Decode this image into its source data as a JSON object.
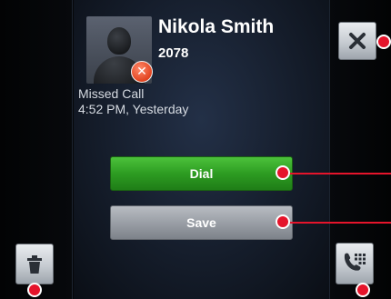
{
  "contact": {
    "name": "Nikola Smith",
    "extension": "2078"
  },
  "call": {
    "status": "Missed Call",
    "time": "4:52 PM, Yesterday"
  },
  "buttons": {
    "dial_label": "Dial",
    "save_label": "Save"
  },
  "icons": {
    "close": "close-icon",
    "trash": "trash-icon",
    "keypad": "dialpad-icon",
    "missed_badge": "missed-call-icon",
    "avatar": "contact-avatar-icon"
  },
  "colors": {
    "dial_button": "#2d9c22",
    "save_button": "#9a9fa6",
    "callout": "#e5142b",
    "missed_badge": "#e2431f"
  }
}
